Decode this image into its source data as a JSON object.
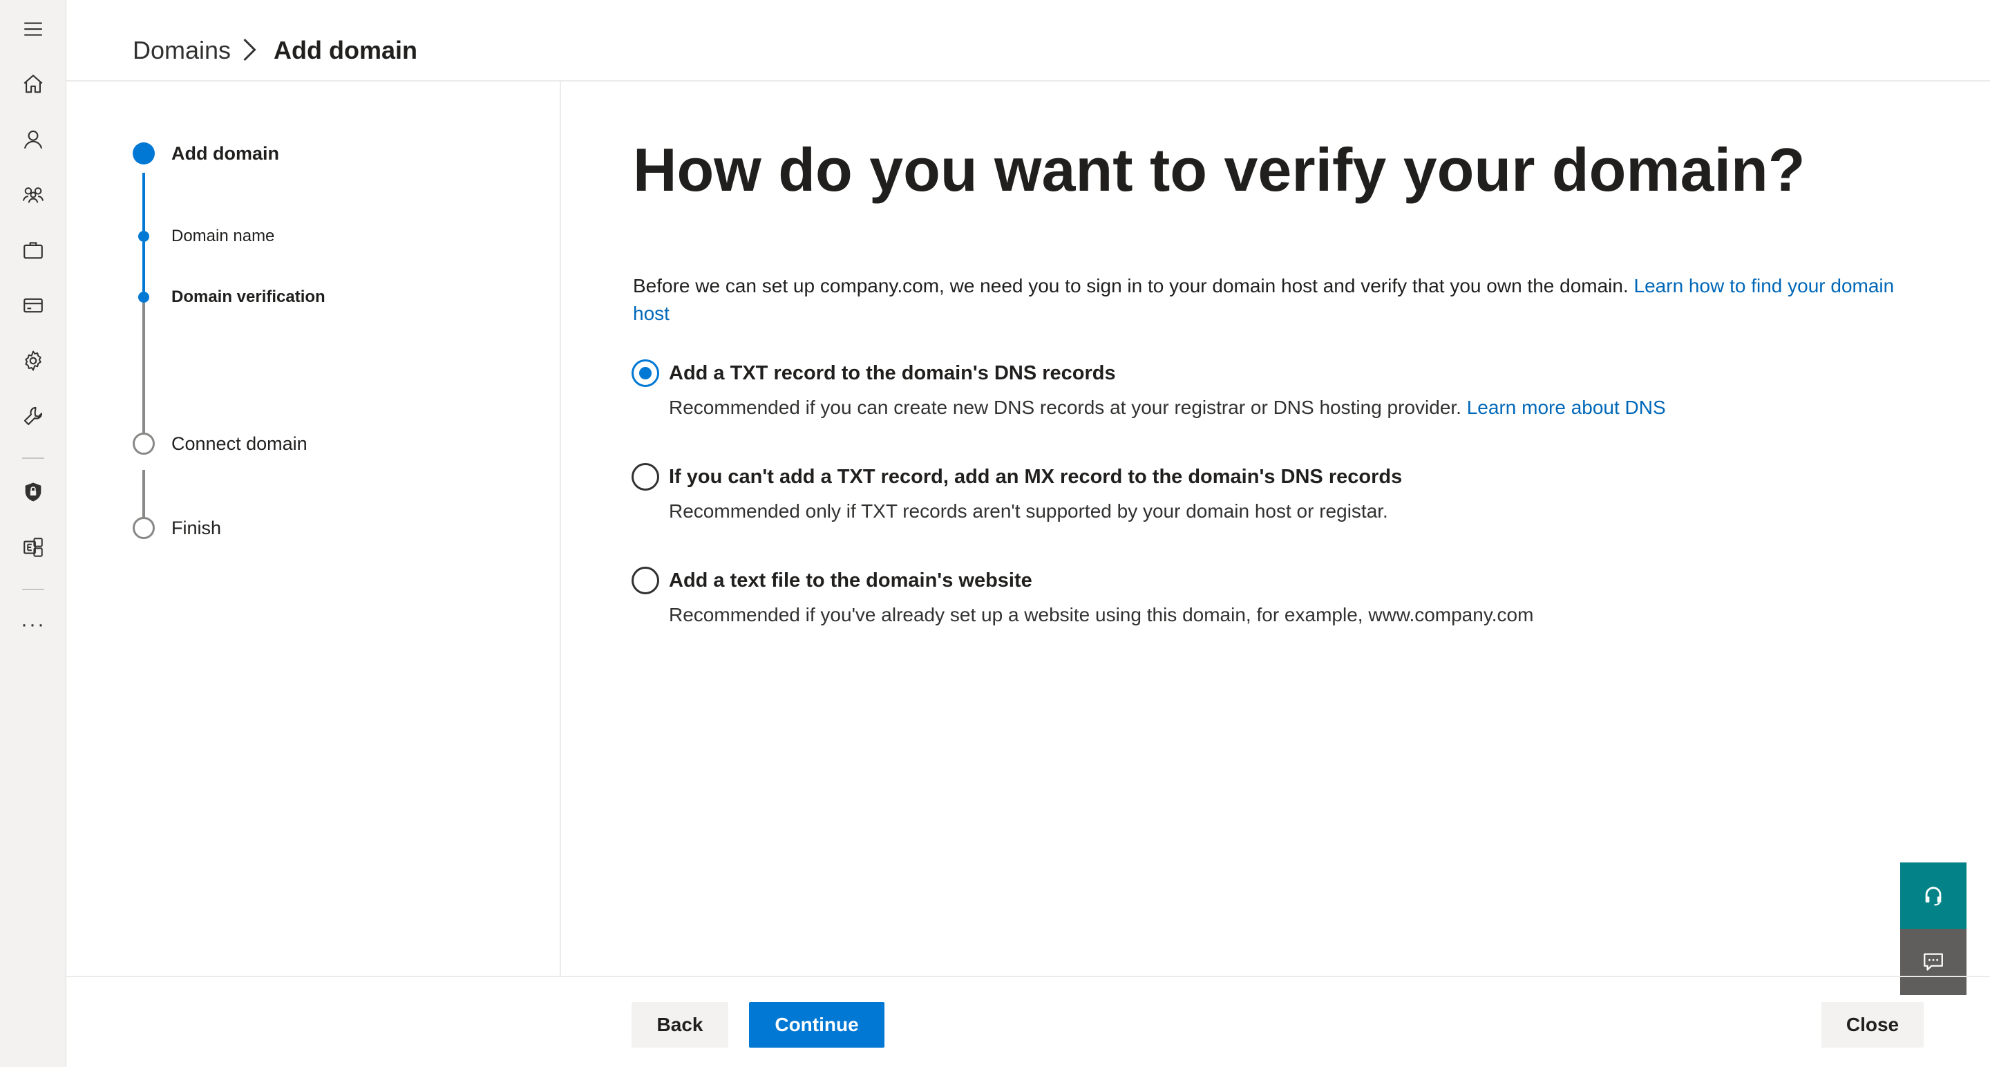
{
  "rail": {
    "icons": [
      "hamburger-icon",
      "home-icon",
      "user-icon",
      "group-icon",
      "briefcase-icon",
      "billing-card-icon",
      "gear-icon",
      "wrench-icon",
      "security-shield-icon",
      "exchange-icon",
      "more-icon"
    ],
    "more_label": "···"
  },
  "breadcrumb": {
    "root": "Domains",
    "current": "Add domain"
  },
  "stepper": {
    "steps": [
      {
        "label": "Add domain",
        "state": "current-group"
      },
      {
        "label": "Domain name",
        "state": "done-sub"
      },
      {
        "label": "Domain verification",
        "state": "current-sub"
      },
      {
        "label": "Connect domain",
        "state": "todo"
      },
      {
        "label": "Finish",
        "state": "todo"
      }
    ]
  },
  "main": {
    "title": "How do you want to verify your domain?",
    "intro_text": "Before we can set up company.com, we need you to sign in to your domain host and verify that you own the domain. ",
    "intro_link": "Learn how to find your domain host",
    "options": [
      {
        "label": "Add a TXT record to the domain's DNS records",
        "description": "Recommended if you can create new DNS records at your registrar or DNS hosting provider. ",
        "link": "Learn more about DNS",
        "selected": true
      },
      {
        "label": "If you can't add a TXT record, add an MX record to the domain's DNS records",
        "description": "Recommended only if TXT records aren't supported by your domain host or registar.",
        "selected": false
      },
      {
        "label": "Add a text file to the domain's website",
        "description": "Recommended if you've already set up a website using this domain, for example, www.company.com",
        "selected": false
      }
    ]
  },
  "footer": {
    "back_label": "Back",
    "continue_label": "Continue",
    "close_label": "Close"
  },
  "floating": {
    "help_icon": "headset-icon",
    "feedback_icon": "feedback-icon"
  },
  "colors": {
    "accent": "#0078d4",
    "link": "#0067b8",
    "help_teal": "#038387",
    "feedback_gray": "#605e5c",
    "rail_bg": "#f3f2f1"
  }
}
